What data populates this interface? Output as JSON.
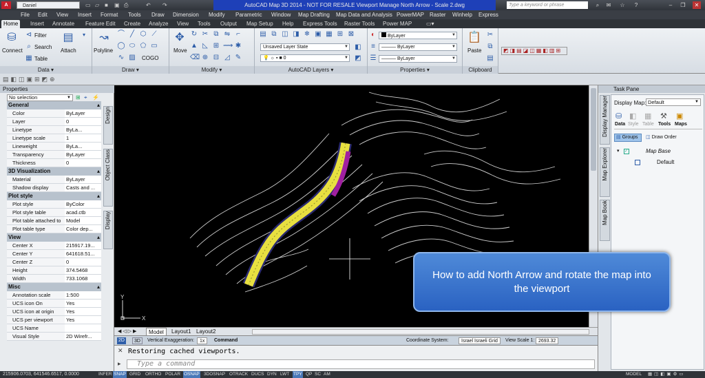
{
  "titlebar": {
    "workspace": "Daniel",
    "title": "AutoCAD Map 3D 2014 - NOT FOR RESALE   Viewport Manage North Arrow - Scale 2.dwg",
    "search_placeholder": "Type a keyword or phrase"
  },
  "menu": [
    "File",
    "Edit",
    "View",
    "Insert",
    "Format",
    "Tools",
    "Draw",
    "Dimension",
    "Modify",
    "Parametric",
    "Window",
    "Map Drafting",
    "Map Data and Analysis",
    "PowerMAP",
    "Raster",
    "Winhelp",
    "Express"
  ],
  "ribbon_tabs": [
    "Home",
    "Insert",
    "Annotate",
    "Feature Edit",
    "Create",
    "Analyze",
    "View",
    "Tools",
    "Output",
    "Map Setup",
    "Help",
    "Express Tools",
    "Raster Tools",
    "Power MAP"
  ],
  "ribbon": {
    "data": {
      "title": "Data",
      "connect": "Connect",
      "filter": "Filter",
      "search": "Search",
      "table": "Table",
      "attach": "Attach"
    },
    "draw": {
      "title": "Draw",
      "polyline": "Polyline",
      "cogo": "COGO"
    },
    "modify": {
      "title": "Modify",
      "move": "Move"
    },
    "layers": {
      "title": "AutoCAD Layers",
      "layer_state": "Unsaved Layer State",
      "current_layer": "0"
    },
    "properties": {
      "title": "Properties",
      "color": "ByLayer",
      "linetype": "ByLayer",
      "lineweight": "ByLayer"
    },
    "clipboard": {
      "title": "Clipboard",
      "paste": "Paste"
    }
  },
  "properties_palette": {
    "title": "Properties",
    "selection": "No selection",
    "sections": [
      {
        "name": "General",
        "rows": [
          [
            "Color",
            "ByLayer"
          ],
          [
            "Layer",
            "0"
          ],
          [
            "Linetype",
            "ByLa..."
          ],
          [
            "Linetype scale",
            "1"
          ],
          [
            "Lineweight",
            "ByLa..."
          ],
          [
            "Transparency",
            "ByLayer"
          ],
          [
            "Thickness",
            "0"
          ]
        ]
      },
      {
        "name": "3D Visualization",
        "rows": [
          [
            "Material",
            "ByLayer"
          ],
          [
            "Shadow display",
            "Casts and ..."
          ]
        ]
      },
      {
        "name": "Plot style",
        "rows": [
          [
            "Plot style",
            "ByColor"
          ],
          [
            "Plot style table",
            "acad.ctb"
          ],
          [
            "Plot table attached to",
            "Model"
          ],
          [
            "Plot table type",
            "Color dep..."
          ]
        ]
      },
      {
        "name": "View",
        "rows": [
          [
            "Center X",
            "215917.19..."
          ],
          [
            "Center Y",
            "641618.51..."
          ],
          [
            "Center Z",
            "0"
          ],
          [
            "Height",
            "374.5468"
          ],
          [
            "Width",
            "733.1068"
          ]
        ]
      },
      {
        "name": "Misc",
        "rows": [
          [
            "Annotation scale",
            "1:500"
          ],
          [
            "UCS icon On",
            "Yes"
          ],
          [
            "UCS icon at origin",
            "Yes"
          ],
          [
            "UCS per viewport",
            "Yes"
          ],
          [
            "UCS Name",
            ""
          ],
          [
            "Visual Style",
            "2D Wirefr..."
          ]
        ]
      }
    ],
    "side_tabs": [
      "Design",
      "Object Class",
      "Display"
    ]
  },
  "canvas": {
    "ucs_y": "Y",
    "ucs_x": "X",
    "layout_tabs": [
      "Model",
      "Layout1",
      "Layout2"
    ]
  },
  "mapbar": {
    "mode_2d": "2D",
    "mode_3d": "3D",
    "vertical_exaggeration_label": "Vertical Exaggeration:",
    "vertical_exaggeration_value": "1x",
    "command": "Command",
    "coord_system_label": "Coordinate System:",
    "coord_system_value": "Israel Israeli Grid",
    "view_scale_label": "View Scale 1:",
    "view_scale_value": "2693.32"
  },
  "command_window": {
    "history": "Restoring cached viewports.",
    "prompt_placeholder": "Type a command"
  },
  "task_pane": {
    "title": "Task Pane",
    "display_map_label": "Display Map:",
    "display_map_value": "Default",
    "tools": [
      "Data",
      "Style",
      "Table",
      "Tools",
      "Maps"
    ],
    "groups": "Groups",
    "draw_order": "Draw Order",
    "map_base": "Map Base",
    "default_layer": "Default",
    "side_tabs": [
      "Display Manager",
      "Map Explorer",
      "Map Book"
    ]
  },
  "statusbar": {
    "coords": "215906.0703, 641546.6517, 0.0000",
    "toggles": [
      "INFER",
      "SNAP",
      "GRID",
      "ORTHO",
      "POLAR",
      "OSNAP",
      "3DOSNAP",
      "OTRACK",
      "DUCS",
      "DYN",
      "LWT",
      "TPY",
      "QP",
      "SC",
      "AM"
    ],
    "model": "MODEL"
  },
  "callout": {
    "text": "How to add North Arrow and rotate the map into the viewport"
  }
}
